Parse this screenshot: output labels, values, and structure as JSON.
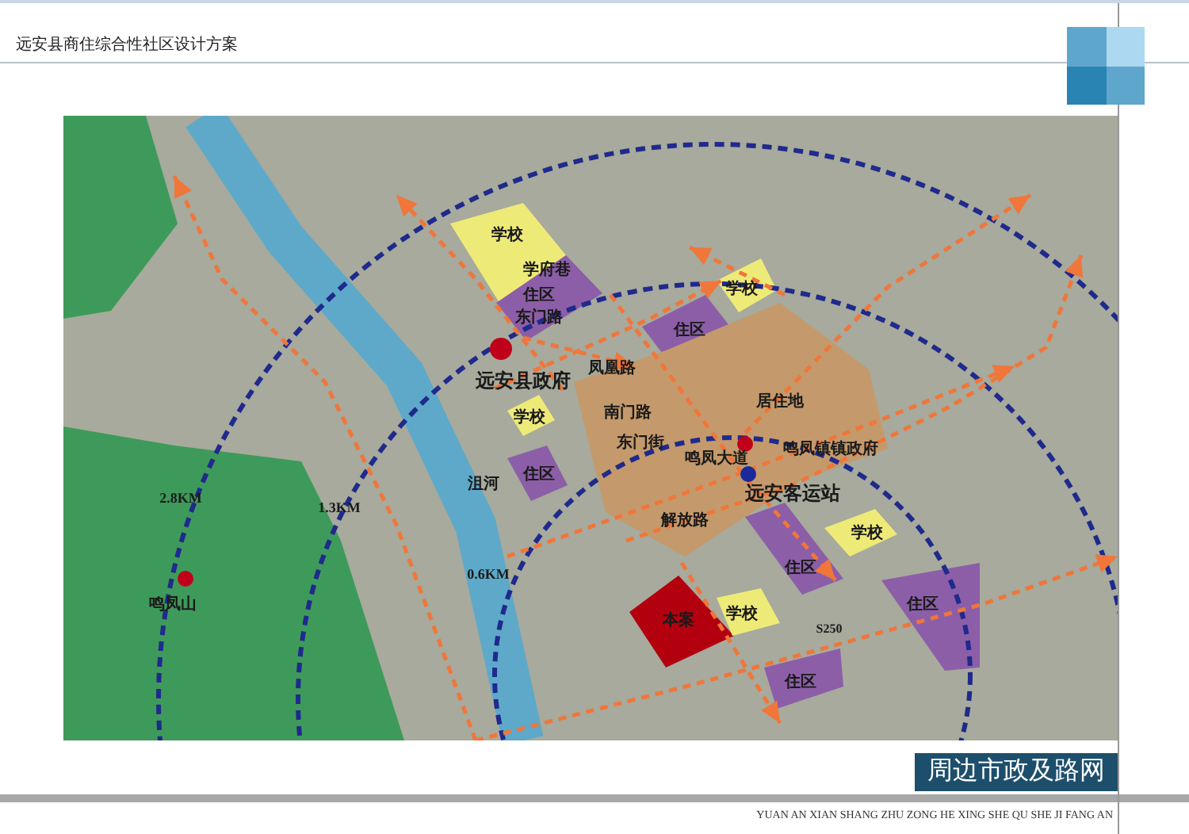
{
  "header": {
    "title": "远安县商住综合性社区设计方案"
  },
  "map": {
    "zones": [
      {
        "labels": [
          "学校"
        ],
        "color": "#eeea78"
      },
      {
        "labels": [
          "学府巷",
          "住区",
          "东门路"
        ],
        "color": "#8c5ea8"
      },
      {
        "labels": [
          "住区"
        ],
        "color": "#8c5ea8"
      },
      {
        "labels": [
          "学校"
        ],
        "color": "#eeea78"
      },
      {
        "labels": [
          "居住地",
          "南门路",
          "东门街",
          "解放路"
        ],
        "color": "#c49a6c"
      },
      {
        "labels": [
          "学校"
        ],
        "color": "#eeea78"
      },
      {
        "labels": [
          "住区"
        ],
        "color": "#8c5ea8"
      },
      {
        "labels": [
          "住区"
        ],
        "color": "#8c5ea8"
      },
      {
        "labels": [
          "学校"
        ],
        "color": "#eeea78"
      },
      {
        "labels": [
          "住区"
        ],
        "color": "#8c5ea8"
      },
      {
        "labels": [
          "本案"
        ],
        "color": "#b3000f"
      },
      {
        "labels": [
          "学校"
        ],
        "color": "#eeea78"
      },
      {
        "labels": [
          "住区"
        ],
        "color": "#8c5ea8"
      }
    ],
    "points": [
      {
        "label": "远安县政府",
        "color": "#c0001a"
      },
      {
        "label": "鸣凤镇镇政府",
        "color": "#c0001a"
      },
      {
        "label": "远安客运站",
        "color": "#1a2a9a"
      },
      {
        "label": "鸣凤山",
        "color": "#c0001a"
      }
    ],
    "labels": [
      "凤凰路",
      "鸣凤大道",
      "沮河",
      "S250"
    ],
    "rings": [
      {
        "label": "2.8KM"
      },
      {
        "label": "1.3KM"
      },
      {
        "label": "0.6KM"
      }
    ]
  },
  "caption": "周边市政及路网",
  "footer": "YUAN AN XIAN SHANG ZHU ZONG HE XING SHE QU SHE JI FANG AN"
}
